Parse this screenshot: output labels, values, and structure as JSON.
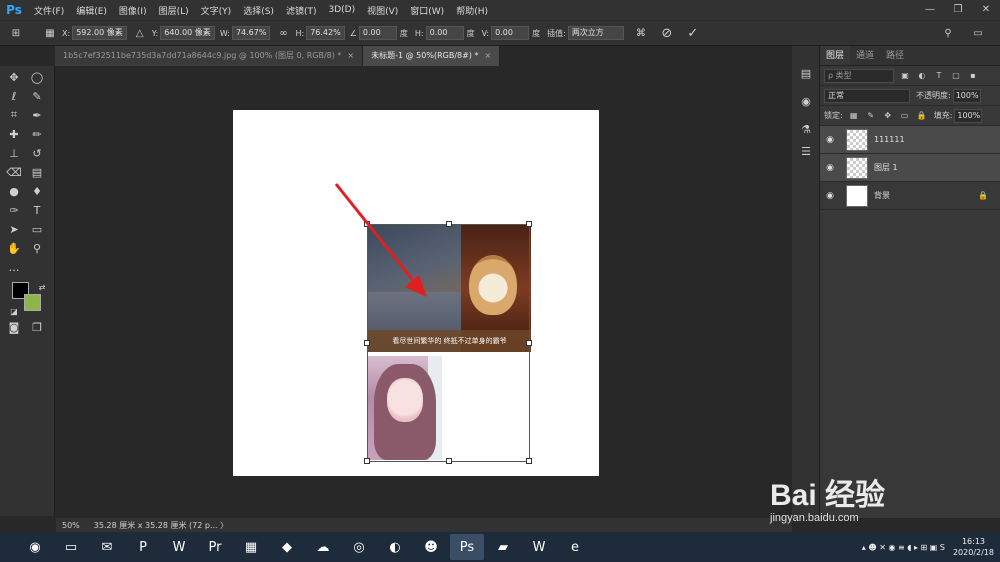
{
  "menu": {
    "logo": "Ps",
    "items": [
      "文件(F)",
      "编辑(E)",
      "图像(I)",
      "图层(L)",
      "文字(Y)",
      "选择(S)",
      "滤镜(T)",
      "3D(D)",
      "视图(V)",
      "窗口(W)",
      "帮助(H)"
    ]
  },
  "options": {
    "x_label": "X:",
    "x_value": "592.00 像素",
    "y_label": "Y:",
    "y_value": "640.00 像素",
    "w_label": "W:",
    "w_value": "74.67%",
    "h_label": "H:",
    "h_value": "76.42%",
    "angle_value": "0.00",
    "angle_unit": "度",
    "hskew_label": "H:",
    "hskew_value": "0.00",
    "hskew_unit": "度",
    "vskew_label": "V:",
    "vskew_value": "0.00",
    "vskew_unit": "度",
    "interp_label": "插值:",
    "interp_value": "两次立方"
  },
  "tabs": [
    {
      "label": "1b5c7ef32511be735d3a7dd71a8644c9.jpg @ 100% (图层 0, RGB/8) *",
      "active": false
    },
    {
      "label": "未标题-1 @ 50%(RGB/8#) *",
      "active": true
    }
  ],
  "canvas": {
    "caption": "看尽世间繁华的 终抵不过单身的霸爷"
  },
  "layers_panel": {
    "tabs": [
      "图层",
      "通道",
      "路径"
    ],
    "filter_placeholder": "ρ 类型",
    "blend_mode": "正常",
    "opacity_label": "不透明度:",
    "opacity_value": "100%",
    "lock_label": "锁定:",
    "fill_label": "填充:",
    "fill_value": "100%",
    "layers": [
      {
        "name": "111111",
        "selected": true
      },
      {
        "name": "图层 1",
        "selected": true
      },
      {
        "name": "背景",
        "selected": false
      }
    ]
  },
  "status": {
    "zoom": "50%",
    "doc_info": "35.28 厘米 x 35.28 厘米 (72 p... 〉"
  },
  "taskbar": {
    "time": "16:13",
    "date": "2020/2/18"
  },
  "watermark": {
    "brand": "Bai 经验",
    "url": "jingyan.baidu.com"
  },
  "colors": {
    "foreground": "#000000",
    "background": "#8cb54a",
    "accent": "#31a8ff",
    "arrow": "#e02020"
  }
}
